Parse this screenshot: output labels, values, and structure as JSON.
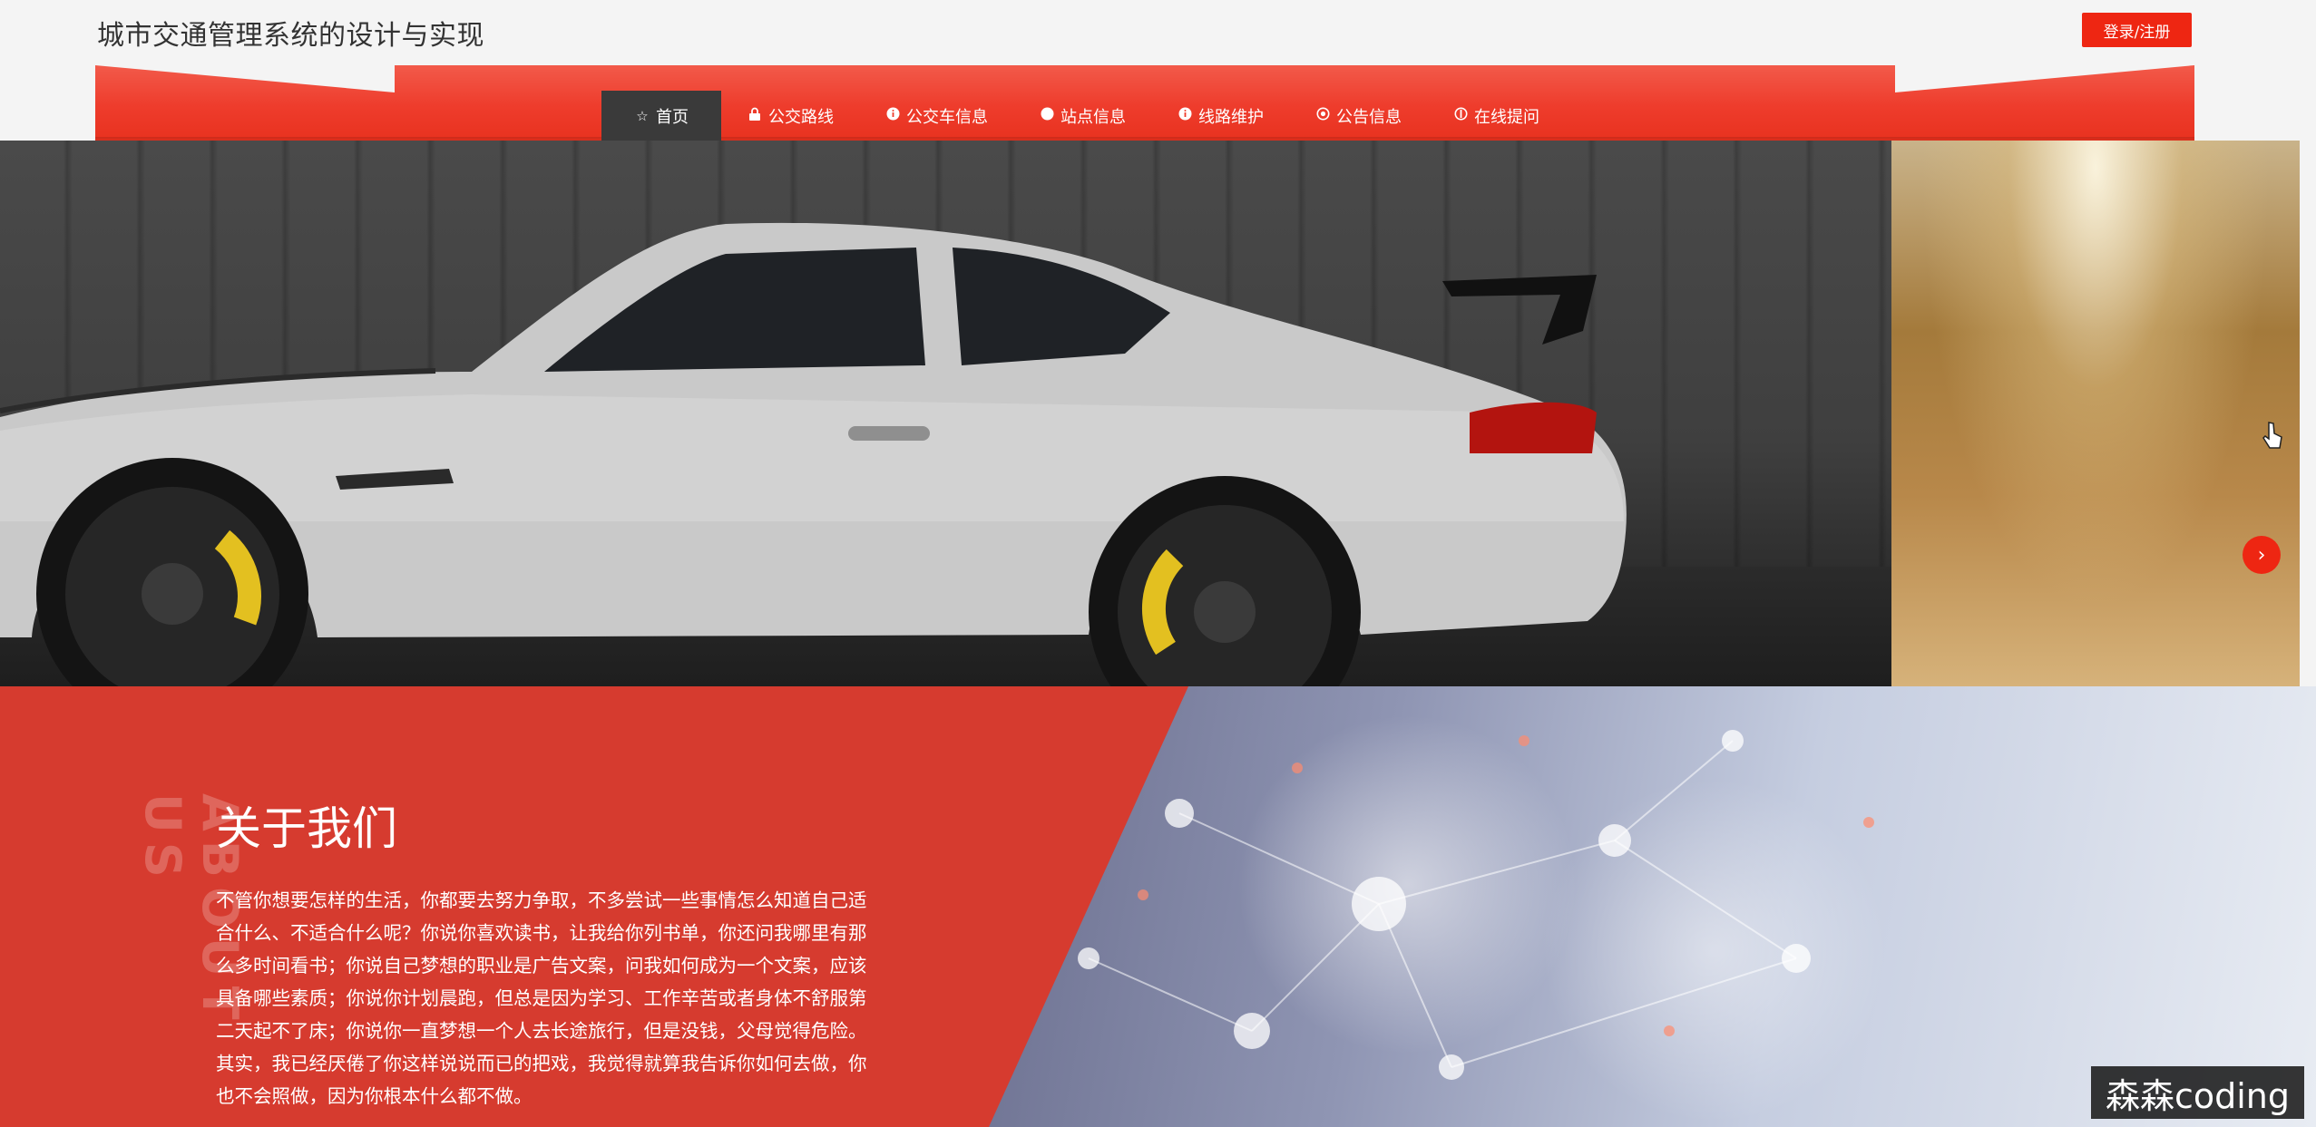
{
  "header": {
    "site_title": "城市交通管理系统的设计与实现",
    "login_label": "登录/注册"
  },
  "nav": {
    "items": [
      {
        "label": "首页",
        "icon": "star-icon",
        "glyph": "☆",
        "active": true
      },
      {
        "label": "公交路线",
        "icon": "lock-icon",
        "glyph": "🔒",
        "active": false
      },
      {
        "label": "公交车信息",
        "icon": "info-icon",
        "glyph": "●",
        "active": false
      },
      {
        "label": "站点信息",
        "icon": "circle-icon",
        "glyph": "●",
        "active": false
      },
      {
        "label": "线路维护",
        "icon": "info-icon",
        "glyph": "●",
        "active": false
      },
      {
        "label": "公告信息",
        "icon": "settings-icon",
        "glyph": "◎",
        "active": false
      },
      {
        "label": "在线提问",
        "icon": "question-icon",
        "glyph": "◐",
        "active": false
      }
    ]
  },
  "banner": {
    "next_glyph": "›"
  },
  "about": {
    "vertical_label": "ABOUT US",
    "heading": "关于我们",
    "text": "不管你想要怎样的生活，你都要去努力争取，不多尝试一些事情怎么知道自己适合什么、不适合什么呢？你说你喜欢读书，让我给你列书单，你还问我哪里有那么多时间看书；你说自己梦想的职业是广告文案，问我如何成为一个文案，应该具备哪些素质；你说你计划晨跑，但总是因为学习、工作辛苦或者身体不舒服第二天起不了床；你说你一直梦想一个人去长途旅行，但是没钱，父母觉得危险。其实，我已经厌倦了你这样说说而已的把戏，我觉得就算我告诉你如何去做，你也不会照做，因为你根本什么都不做。"
  },
  "watermark": "森森coding",
  "colors": {
    "accent": "#ee2612",
    "about_red": "#d63b2f",
    "nav_active": "#3a3a3a"
  }
}
